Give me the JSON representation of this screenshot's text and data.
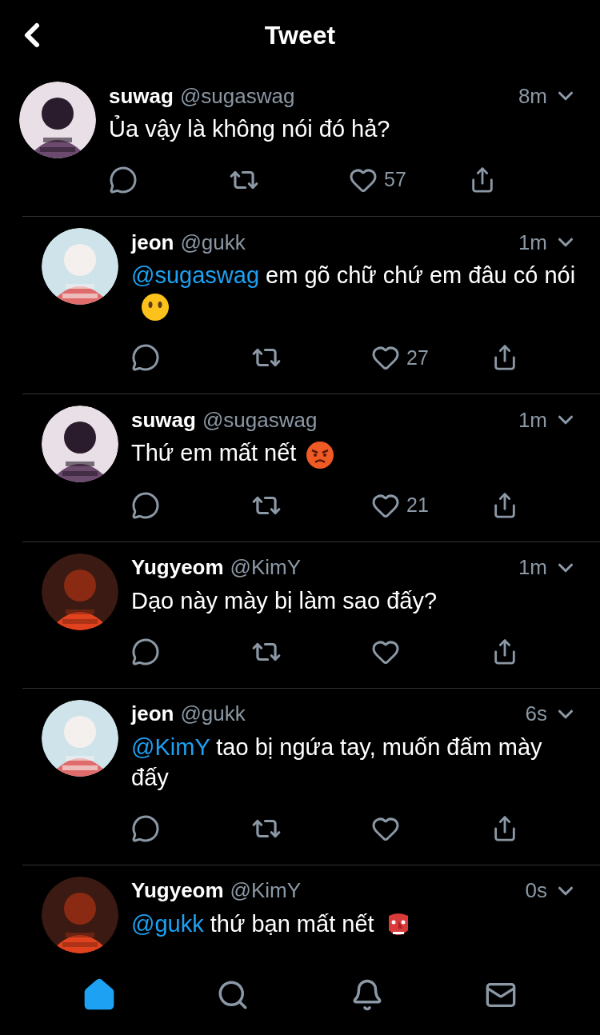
{
  "header": {
    "title": "Tweet"
  },
  "tweets": [
    {
      "name": "suwag",
      "handle": "@sugaswag",
      "time": "8m",
      "avatar": {
        "kind": "picture"
      },
      "parts": [
        {
          "kind": "text",
          "text": "Ủa vậy là không nói đó hả?"
        }
      ],
      "actions_visible": true,
      "likes": "57"
    },
    {
      "name": "jeon",
      "handle": "@gukk",
      "time": "1m",
      "avatar": {
        "kind": "picture"
      },
      "parts": [
        {
          "kind": "mention",
          "text": "@sugaswag"
        },
        {
          "kind": "text",
          "text": " em gõ chữ chứ em đâu có nói"
        },
        {
          "kind": "mouthless"
        }
      ],
      "actions_visible": true,
      "likes": "27"
    },
    {
      "name": "suwag",
      "handle": "@sugaswag",
      "time": "1m",
      "avatar": {
        "kind": "picture"
      },
      "parts": [
        {
          "kind": "text",
          "text": "Thứ em mất nết"
        },
        {
          "kind": "angry"
        }
      ],
      "actions_visible": true,
      "likes": "21"
    },
    {
      "name": "Yugyeom",
      "handle": "@KimY",
      "time": "1m",
      "avatar": {
        "kind": "picture"
      },
      "parts": [
        {
          "kind": "text",
          "text": "Dạo này mày bị làm sao đấy?"
        }
      ],
      "actions_visible": true
    },
    {
      "name": "jeon",
      "handle": "@gukk",
      "time": "6s",
      "avatar": {
        "kind": "picture"
      },
      "parts": [
        {
          "kind": "mention",
          "text": "@KimY"
        },
        {
          "kind": "text",
          "text": " tao bị ngứa tay, muốn đấm mày đấy"
        }
      ],
      "actions_visible": true
    },
    {
      "name": "Yugyeom",
      "handle": "@KimY",
      "time": "0s",
      "avatar": {
        "kind": "picture"
      },
      "parts": [
        {
          "kind": "mention",
          "text": "@gukk"
        },
        {
          "kind": "text",
          "text": " thứ bạn mất nết"
        },
        {
          "kind": "goblin"
        }
      ],
      "actions_visible": false
    }
  ],
  "tabs": [
    {
      "kind": "home",
      "selected": true
    },
    {
      "kind": "search",
      "selected": false
    },
    {
      "kind": "notifications",
      "selected": false
    },
    {
      "kind": "messages",
      "selected": false
    }
  ]
}
